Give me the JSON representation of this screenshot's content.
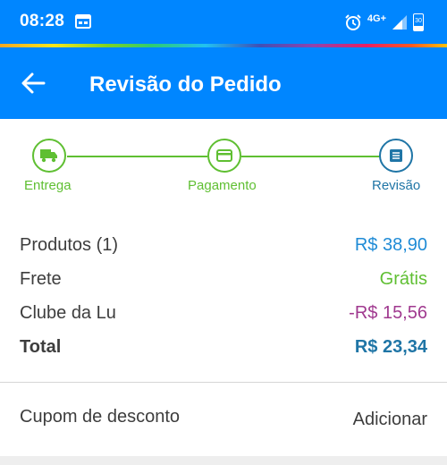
{
  "status_bar": {
    "time": "08:28",
    "network": "4G+",
    "battery": "30",
    "icons": [
      "calendar-icon",
      "alarm-icon",
      "signal-icon",
      "battery-icon"
    ]
  },
  "app_bar": {
    "title": "Revisão do Pedido",
    "back_icon": "arrow-left-icon"
  },
  "stepper": {
    "steps": [
      {
        "label": "Entrega",
        "icon": "truck-icon",
        "state": "done"
      },
      {
        "label": "Pagamento",
        "icon": "credit-card-icon",
        "state": "done"
      },
      {
        "label": "Revisão",
        "icon": "receipt-icon",
        "state": "active"
      }
    ]
  },
  "summary": {
    "products": {
      "label": "Produtos (1)",
      "value": "R$ 38,90"
    },
    "shipping": {
      "label": "Frete",
      "value": "Grátis"
    },
    "club": {
      "label": "Clube da Lu",
      "value": "-R$ 15,56"
    },
    "total": {
      "label": "Total",
      "value": "R$ 23,34"
    }
  },
  "coupon": {
    "label": "Cupom de desconto",
    "action": "Adicionar"
  },
  "colors": {
    "primary": "#0086ff",
    "step_done": "#5fbf32",
    "step_active": "#1f75a6",
    "price": "#1f8bd6",
    "free": "#5fbf32",
    "discount": "#a0398f",
    "total": "#1f75a6",
    "text": "#3d3d3d"
  }
}
